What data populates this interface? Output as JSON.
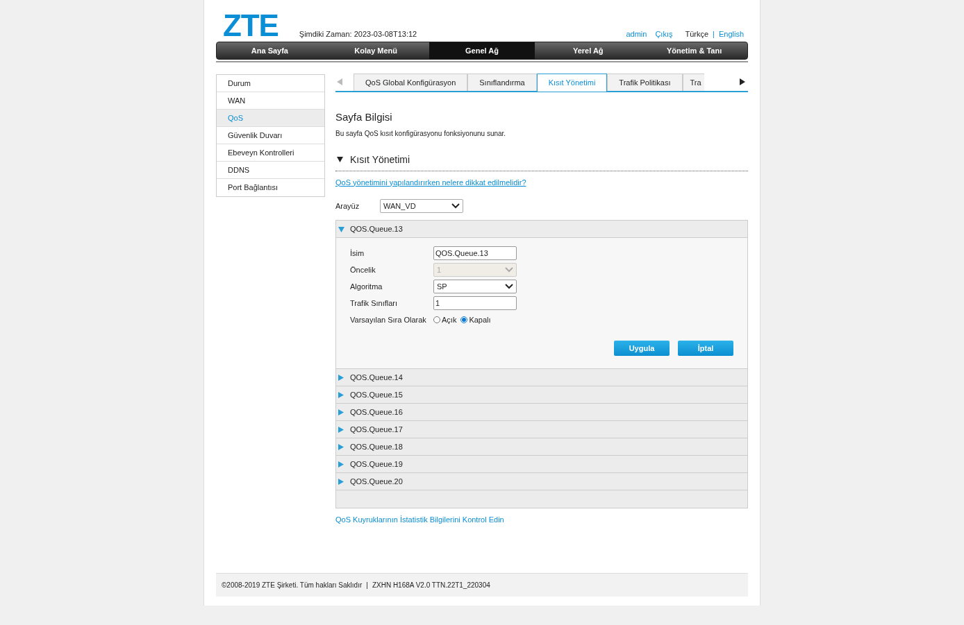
{
  "header": {
    "logo": "ZTE",
    "time": "Şimdiki Zaman: 2023-03-08T13:12",
    "user": "admin",
    "logout": "Çıkış",
    "language_separator": "|",
    "languages": [
      {
        "label": "Türkçe",
        "selected": true
      },
      {
        "label": "English",
        "selected": false
      }
    ]
  },
  "nav": [
    {
      "label": "Ana Sayfa",
      "selected": false
    },
    {
      "label": "Kolay Menü",
      "selected": false
    },
    {
      "label": "Genel Ağ",
      "selected": true
    },
    {
      "label": "Yerel Ağ",
      "selected": false
    },
    {
      "label": "Yönetim & Tanı",
      "selected": false
    }
  ],
  "sidebar": [
    {
      "label": "Durum",
      "selected": false
    },
    {
      "label": "WAN",
      "selected": false
    },
    {
      "label": "QoS",
      "selected": true
    },
    {
      "label": "Güvenlik Duvarı",
      "selected": false
    },
    {
      "label": "Ebeveyn Kontrolleri",
      "selected": false
    },
    {
      "label": "DDNS",
      "selected": false
    },
    {
      "label": "Port Bağlantısı",
      "selected": false
    }
  ],
  "tabs": [
    {
      "label": "QoS Global Konfigürasyon",
      "selected": false
    },
    {
      "label": "Sınıflandırma",
      "selected": false
    },
    {
      "label": "Kısıt Yönetimi",
      "selected": true
    },
    {
      "label": "Trafik Politikası",
      "selected": false
    },
    {
      "label": "Tra",
      "selected": false
    }
  ],
  "page_info": {
    "title": "Sayfa Bilgisi",
    "description": "Bu sayfa QoS kısıt konfigürasyonu fonksiyonunu sunar."
  },
  "section": {
    "title": "Kısıt Yönetimi",
    "expanded": true
  },
  "help_link": "QoS yönetimini yapılandırırken nelere dikkat edilmelidir?",
  "interface": {
    "label": "Arayüz",
    "value": "WAN_VD"
  },
  "queues": [
    {
      "name": "QOS.Queue.13",
      "expanded": true,
      "form": {
        "fields": [
          {
            "kind": "text",
            "label": "İsim",
            "value": "QOS.Queue.13",
            "disabled": false
          },
          {
            "kind": "select",
            "label": "Öncelik",
            "value": "1",
            "disabled": true
          },
          {
            "kind": "select",
            "label": "Algoritma",
            "value": "SP",
            "disabled": false
          },
          {
            "kind": "text",
            "label": "Trafik Sınıfları",
            "value": "1",
            "disabled": false
          }
        ],
        "radio": {
          "label": "Varsayılan Sıra Olarak",
          "options": [
            {
              "label": "Açık",
              "selected": false
            },
            {
              "label": "Kapalı",
              "selected": true
            }
          ]
        },
        "buttons": [
          "Uygula",
          "İptal"
        ]
      }
    },
    {
      "name": "QOS.Queue.14",
      "expanded": false
    },
    {
      "name": "QOS.Queue.15",
      "expanded": false
    },
    {
      "name": "QOS.Queue.16",
      "expanded": false
    },
    {
      "name": "QOS.Queue.17",
      "expanded": false
    },
    {
      "name": "QOS.Queue.18",
      "expanded": false
    },
    {
      "name": "QOS.Queue.19",
      "expanded": false
    },
    {
      "name": "QOS.Queue.20",
      "expanded": false
    }
  ],
  "stats_link": "QoS Kuyruklarının İstatistik Bilgilerini Kontrol Edin",
  "footer": {
    "copyright": "©2008-2019 ZTE Şirketi. Tüm hakları Saklıdır",
    "separator": "|",
    "version": "ZXHN H168A V2.0 TTN.22T1_220304"
  }
}
